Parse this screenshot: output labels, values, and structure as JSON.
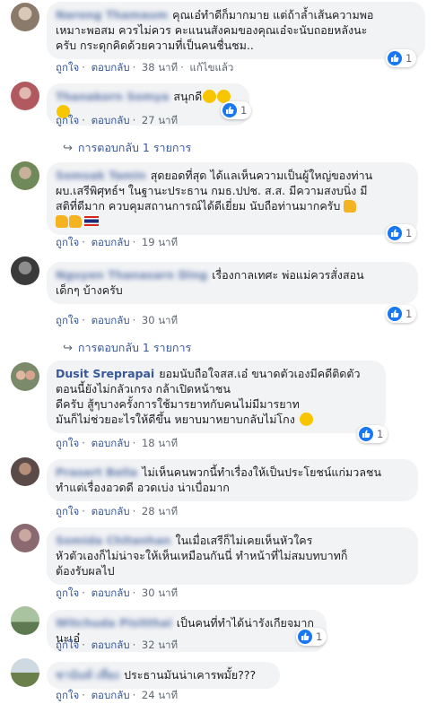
{
  "comments": [
    {
      "name": "Narong Thamaum",
      "lines": [
        "คุณเอ๋ทำดีก็มากมาย แต่ถ้าล้ำเส้นความพอ",
        "เหมาะพอสม ควรไม่ควร คะแนนสังคมของคุณเอ๋จะนับถอยหลังนะ",
        "ครับ กระดุกคิดด้วยความที่เป็นคนชื่นชม.."
      ],
      "like": "ถูกใจ",
      "reply": "ตอบกลับ",
      "time": "38 นาที",
      "edited": "แก้ไขแล้ว",
      "reaction_count": "1"
    },
    {
      "name": "Thanakorn Somya",
      "lines": [
        "สนุกดี"
      ],
      "emojis": 3,
      "like": "ถูกใจ",
      "reply": "ตอบกลับ",
      "time": "27 นาที",
      "reaction_count": "1",
      "replies_text": "การตอบกลับ 1 รายการ"
    },
    {
      "name": "Somsak Tamin",
      "lines": [
        "สุดยอดที่สุด ได้แลเห็นความเป็นผู้ใหญ่ของท่าน",
        "ผบ.เสรีพิศุทธ์ฯ ในฐานะประธาน กมธ.ปปช. ส.ส. มีความสงบนิ่ง มี",
        "สติที่ดีมาก ควบคุมสถานการณ์ได้ดีเยี่ยม นับถือท่านมากครับ"
      ],
      "like": "ถูกใจ",
      "reply": "ตอบกลับ",
      "time": "19 นาที",
      "reaction_count": "1"
    },
    {
      "name": "Nguyen Thanasarn Ding",
      "lines": [
        "เรื่องกาลเทศะ พ่อแม่ควรสั่งสอน",
        "เด็กๆ บ้างครับ"
      ],
      "like": "ถูกใจ",
      "reply": "ตอบกลับ",
      "time": "30 นาที",
      "reaction_count": "1",
      "replies_text": "การตอบกลับ 1 รายการ"
    },
    {
      "name": "Dusit Sreprapai",
      "lines": [
        "ยอมนับถือใจสส.เอ๋ ขนาดตัวเองมีคดีติดตัว",
        "ตอนนี้ยังไม่กลัวเกรง กล้าเปิดหน้าชน",
        "ดีครับ สู้ๆบางครั้งการใช้มารยาทกับคนไม่มีมารยาท",
        "มันก็ไม่ช่วยอะไรให้ดีขึ้น หยาบมาหยาบกลับไม่โกง"
      ],
      "like": "ถูกใจ",
      "reply": "ตอบกลับ",
      "time": "18 นาที",
      "reaction_count": "1"
    },
    {
      "name": "Prasert Bella",
      "lines": [
        "ไม่เห็นคนพวกนี้ทำเรื่องให้เป็นประโยชน์แก่มวลชน",
        "ทำแต่เรื่องอวดดี อวดเบ่ง น่าเบื่อมาก"
      ],
      "like": "ถูกใจ",
      "reply": "ตอบกลับ",
      "time": "28 นาที"
    },
    {
      "name": "Somida Chitanhan",
      "lines": [
        "ในเมื่อเสรีก็ไม่เคยเห็นหัวใคร",
        "หัวตัวเองก็ไม่น่าจะให้เห็นเหมือนกันนี่ ทำหน้าที่ไม่สมบทบาทก็",
        "ต้องรับผลไป"
      ],
      "like": "ถูกใจ",
      "reply": "ตอบกลับ",
      "time": "30 นาที"
    },
    {
      "name": "Witchuda Pisitthai",
      "lines": [
        "เป็นคนที่ทำได้น่ารังเกียจมากนะเอ๋"
      ],
      "like": "ถูกใจ",
      "reply": "ตอบกลับ",
      "time": "32 นาที",
      "reaction_count": "1"
    },
    {
      "name": "ชานันท์ เที่ยง",
      "lines": [
        "ประธานมันน่าเคารพมั้ย???"
      ],
      "like": "ถูกใจ",
      "reply": "ตอบกลับ",
      "time": "24 นาที"
    }
  ]
}
